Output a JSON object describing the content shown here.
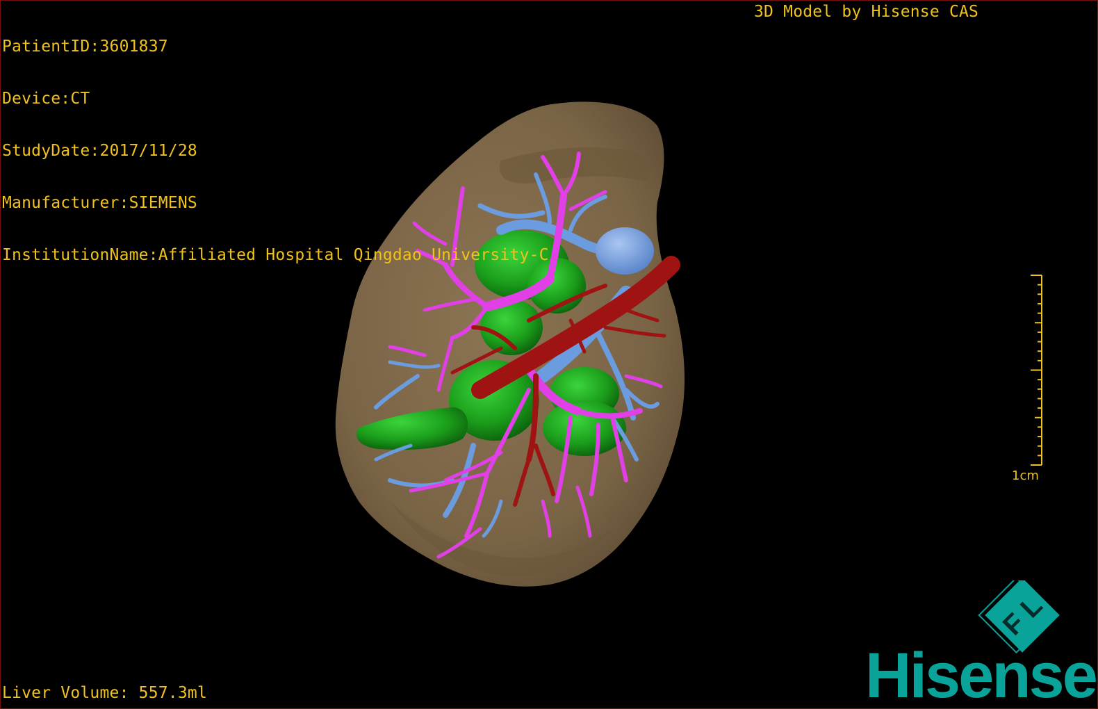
{
  "study_info": {
    "patient_id": "PatientID:3601837",
    "device": "Device:CT",
    "study_date": "StudyDate:2017/11/28",
    "manufacturer": "Manufacturer:SIEMENS",
    "institution": "InstitutionName:Affiliated Hospital Qingdao University-C"
  },
  "viewer": {
    "title": "3D Model by Hisense CAS"
  },
  "measurements": {
    "liver_volume": "Liver Volume: 557.3ml"
  },
  "scale_bar": {
    "label": "1cm",
    "color": "#f1c21b"
  },
  "logo": {
    "brand": "Hisense",
    "emblem_text": "F L",
    "color": "#0aa39a"
  },
  "model_colors": {
    "liver": "#7d6748",
    "tumor": "#1ca31c",
    "portal_vein": "#e040e6",
    "hepatic_vein": "#6c9ce0",
    "artery": "#a01313"
  }
}
